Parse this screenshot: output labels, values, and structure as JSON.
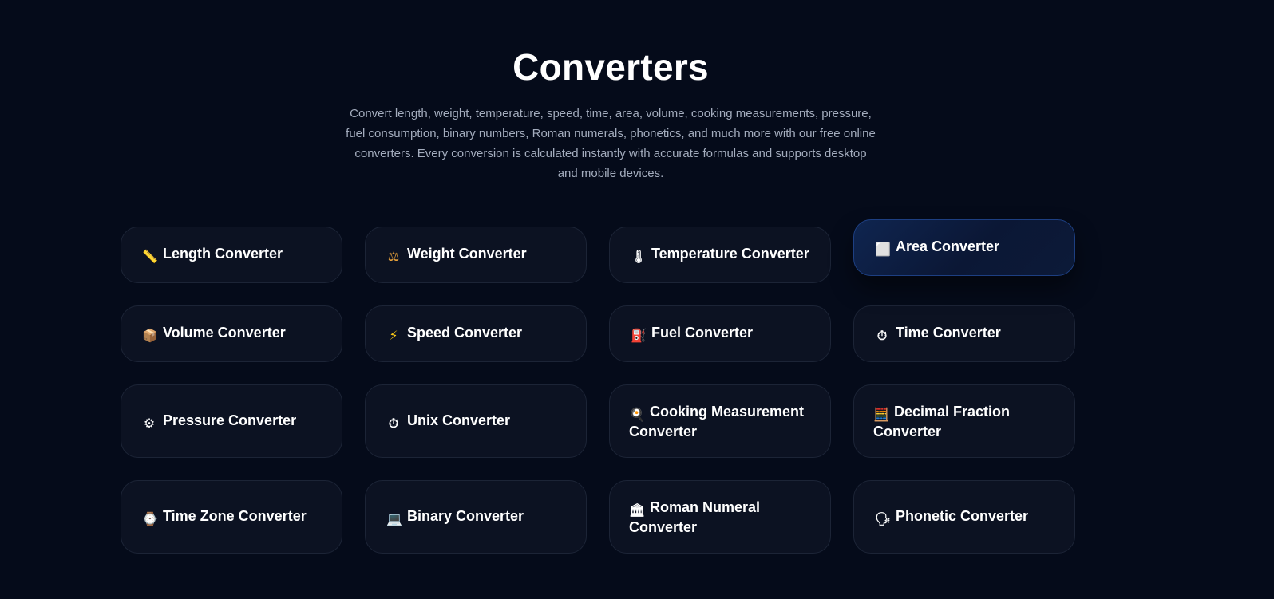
{
  "header": {
    "title": "Converters",
    "intro": "Convert length, weight, temperature, speed, time, area, volume, cooking measurements, pressure, fuel consumption, binary numbers, Roman numerals, phonetics, and much more with our free online converters. Every conversion is calculated instantly with accurate formulas and supports desktop and mobile devices."
  },
  "converters": [
    {
      "label": "Length Converter",
      "icon": "ruler-icon",
      "glyph": "📏"
    },
    {
      "label": "Weight Converter",
      "icon": "scales-icon",
      "glyph": "⚖"
    },
    {
      "label": "Temperature Converter",
      "icon": "thermometer-icon",
      "glyph": "🌡"
    },
    {
      "label": "Area Converter",
      "icon": "square-icon",
      "glyph": "⬜"
    },
    {
      "label": "Volume Converter",
      "icon": "box-icon",
      "glyph": "📦"
    },
    {
      "label": "Speed Converter",
      "icon": "lightning-icon",
      "glyph": "⚡"
    },
    {
      "label": "Fuel Converter",
      "icon": "fuel-pump-icon",
      "glyph": "⛽"
    },
    {
      "label": "Time Converter",
      "icon": "stopwatch-icon",
      "glyph": "⏱"
    },
    {
      "label": "Pressure Converter",
      "icon": "gear-icon",
      "glyph": "⚙"
    },
    {
      "label": "Unix Converter",
      "icon": "stopwatch-icon",
      "glyph": "⏱"
    },
    {
      "label": "Cooking Measurement Converter",
      "icon": "frying-pan-icon",
      "glyph": "🍳"
    },
    {
      "label": "Decimal Fraction Converter",
      "icon": "abacus-icon",
      "glyph": "🧮"
    },
    {
      "label": "Time Zone Converter",
      "icon": "watch-icon",
      "glyph": "⌚"
    },
    {
      "label": "Binary Converter",
      "icon": "laptop-icon",
      "glyph": "💻"
    },
    {
      "label": "Roman Numeral Converter",
      "icon": "classical-building-icon",
      "glyph": "🏛"
    },
    {
      "label": "Phonetic Converter",
      "icon": "speaking-head-icon",
      "glyph": "🗣"
    }
  ],
  "colors": {
    "background": "#050b1a",
    "card": "#0c1222",
    "card_border": "#1c2436",
    "active_border": "#1d3f82",
    "text": "#ffffff",
    "muted_text": "#a3acbd"
  }
}
